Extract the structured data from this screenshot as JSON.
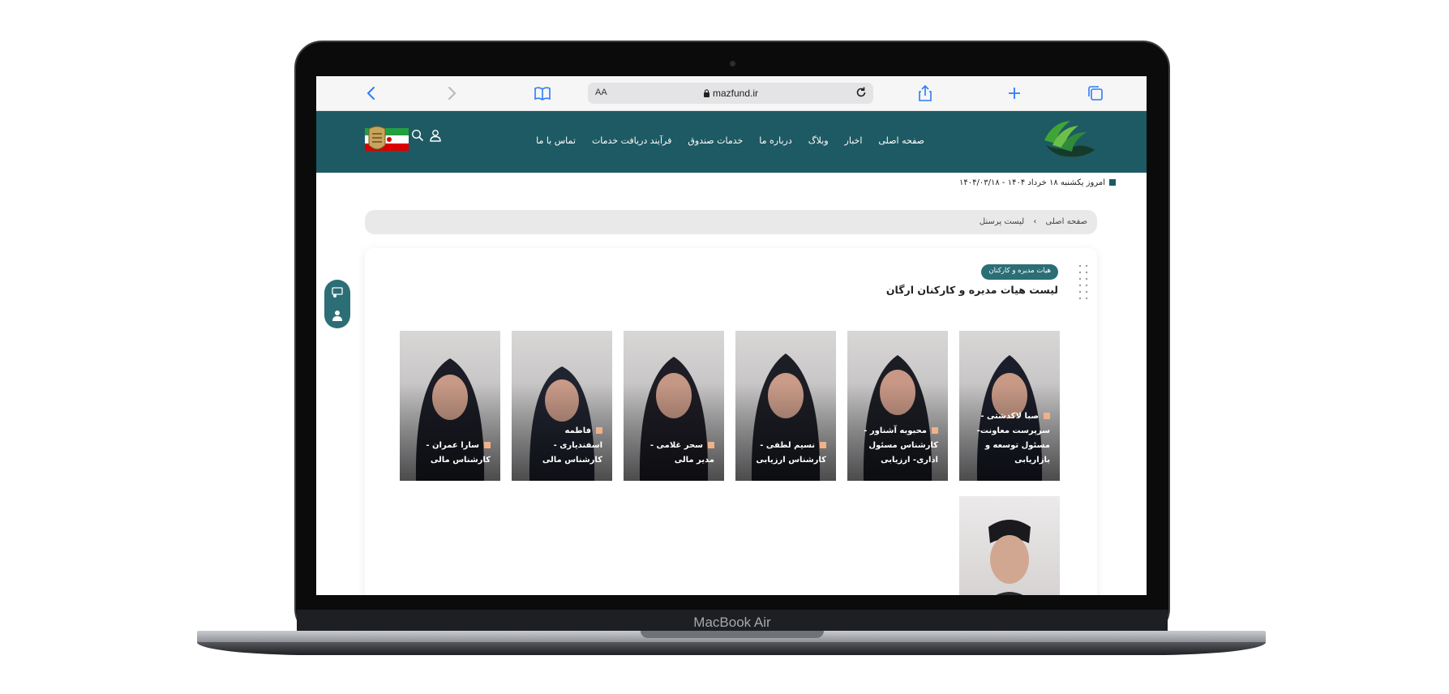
{
  "device": {
    "label": "MacBook Air"
  },
  "browser": {
    "text_size_label": "AA",
    "url": "mazfund.ir"
  },
  "header": {
    "nav": [
      "صفحه اصلی",
      "اخبار",
      "وبلاگ",
      "درباره ما",
      "خدمات صندوق",
      "فرآیند دریافت خدمات",
      "تماس با ما"
    ]
  },
  "date_line": "امروز یکشنبه ۱۸ خرداد ۱۴۰۴ - ۱۴۰۴/۰۳/۱۸",
  "breadcrumb": {
    "home": "صفحه اصلی",
    "separator": "›",
    "current": "لیست پرسنل"
  },
  "section": {
    "badge": "هیات مدیره و کارکنان",
    "title": "لیست هیات مدیره و کارکنان ارگان"
  },
  "people": [
    {
      "name": "صبا لاکدشتی - سرپرست معاونت- مسئول توسعه و بازاریابی"
    },
    {
      "name": "محبوبه آشناور - کارشناس مسئول اداری- ارزیابی"
    },
    {
      "name": "نسیم لطفی - کارشناس ارزیابی"
    },
    {
      "name": "سحر غلامی - مدیر مالی"
    },
    {
      "name": "فاطمه اسفندیاری - کارشناس مالی"
    },
    {
      "name": "سارا عمران - کارشناس مالی"
    }
  ],
  "colors": {
    "header": "#1e5a63",
    "badge": "#2c6e76",
    "accent_square": "#f0b18a",
    "link_blue": "#2d7cf6"
  }
}
